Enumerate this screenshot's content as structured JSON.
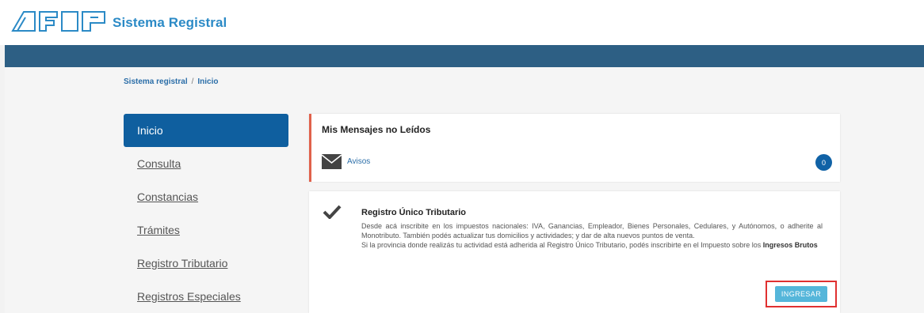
{
  "header": {
    "logo_text": "AFIP",
    "app_title": "Sistema Registral"
  },
  "breadcrumb": {
    "root": "Sistema registral",
    "separator": "/",
    "current": "Inicio"
  },
  "menu": {
    "items": [
      {
        "label": "Inicio",
        "active": true
      },
      {
        "label": "Consulta"
      },
      {
        "label": "Constancias"
      },
      {
        "label": "Trámites"
      },
      {
        "label": "Registro Tributario"
      },
      {
        "label": "Registros Especiales"
      }
    ]
  },
  "messages_card": {
    "title": "Mis Mensajes no Leídos",
    "item_label": "Avisos",
    "count": "0",
    "icon": "envelope-icon"
  },
  "rut_card": {
    "title": "Registro Único Tributario",
    "desc_line1": "Desde acá inscribite en los impuestos nacionales: IVA, Ganancias, Empleador, Bienes Personales, Cedulares, y Autónomos, o adherite al Monotributo. También podés actualizar tus domicilios y actividades; y dar de alta nuevos puntos de venta.",
    "desc_line2_prefix": "Si la provincia donde realizás tu actividad está adherida al Registro Único Tributario, podés inscribirte en el Impuesto sobre los ",
    "desc_line2_bold": "Ingresos Brutos",
    "button": "INGRESAR",
    "icon": "check-icon"
  },
  "colors": {
    "brand_blue": "#2b8ac6",
    "bar": "#2d5f84",
    "active_menu": "#0f5f9f",
    "accent_red": "#e0614b",
    "button": "#55b6da"
  }
}
